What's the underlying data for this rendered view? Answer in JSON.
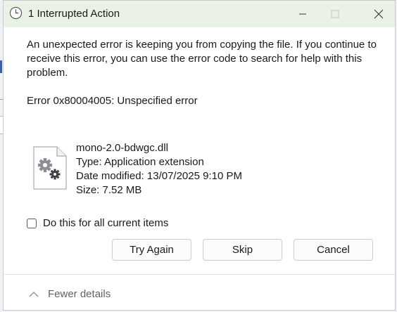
{
  "window": {
    "title": "1 Interrupted Action"
  },
  "message": {
    "text": "An unexpected error is keeping you from copying the file. If you continue to receive this error, you can use the error code to search for help with this problem.",
    "error_code": "Error 0x80004005: Unspecified error"
  },
  "file": {
    "icon": "settings-file-icon",
    "name": "mono-2.0-bdwgc.dll",
    "type": "Type: Application extension",
    "date_modified": "Date modified: 13/07/2025 9:10 PM",
    "size": "Size: 7.52 MB"
  },
  "options": {
    "apply_all_label": "Do this for all current items",
    "apply_all_checked": false
  },
  "buttons": {
    "try_again": "Try Again",
    "skip": "Skip",
    "cancel": "Cancel"
  },
  "details": {
    "toggle_label": "Fewer details"
  },
  "colors": {
    "titlebar": "#e9f2e4",
    "text": "#1a1a1a",
    "muted": "#5f6368"
  }
}
